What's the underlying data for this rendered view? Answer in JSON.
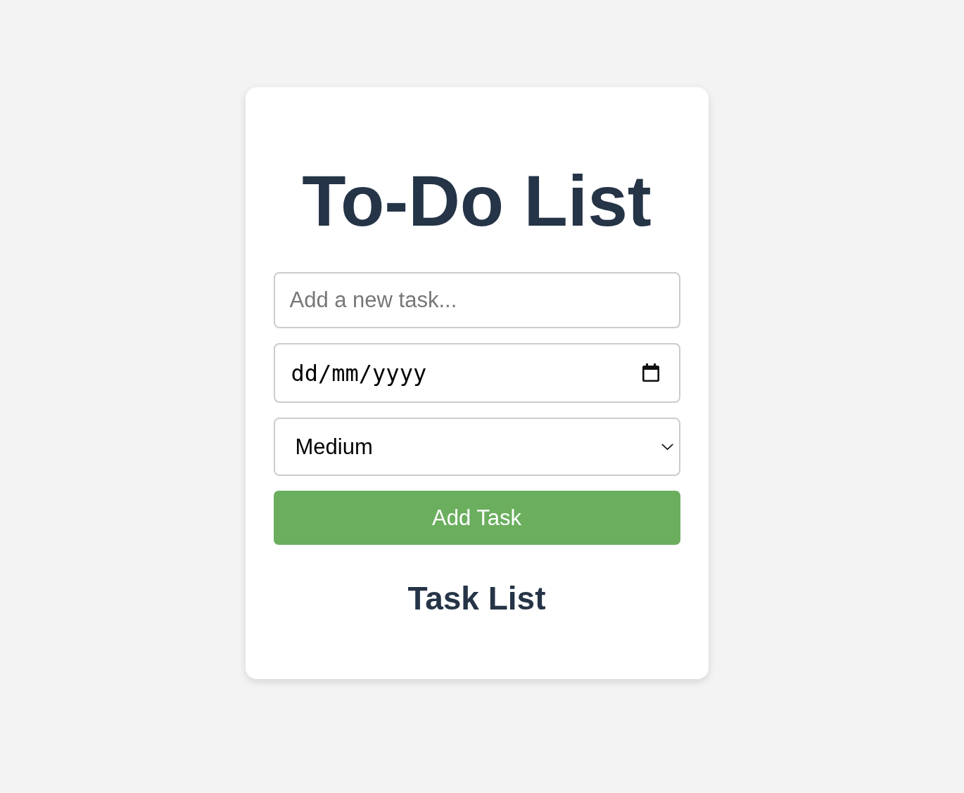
{
  "title": "To-Do List",
  "task_input": {
    "placeholder": "Add a new task..."
  },
  "due_date": {
    "placeholder": "dd/mm/yyyy"
  },
  "priority": {
    "value": "Medium"
  },
  "add_button": {
    "label": "Add Task"
  },
  "task_list": {
    "heading": "Task List"
  }
}
